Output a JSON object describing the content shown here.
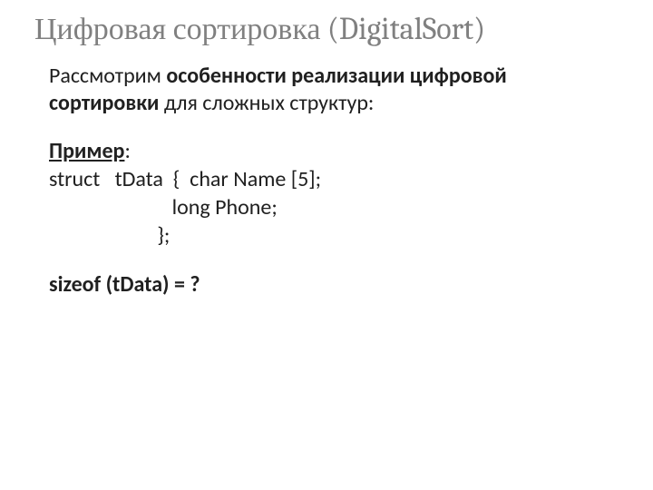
{
  "title": "Цифровая сортировка (DigitalSort)",
  "intro": {
    "prefix": "Рассмотрим ",
    "strong": "особенности реализации цифровой сортировки",
    "suffix": " для сложных структур:"
  },
  "example": {
    "label": "Пример",
    "colon": ":",
    "code_line1": "struct   tData  {  char Name [5];",
    "code_line2": "                         long Phone;",
    "code_line3": "                      };"
  },
  "question": "sizeof (tData) = ?"
}
